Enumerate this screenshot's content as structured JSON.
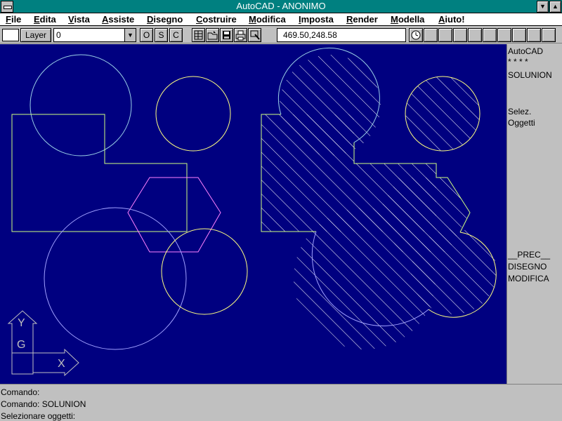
{
  "window": {
    "title": "AutoCAD - ANONIMO"
  },
  "menu": {
    "items": [
      {
        "label": "File"
      },
      {
        "label": "Edita"
      },
      {
        "label": "Vista"
      },
      {
        "label": "Assiste"
      },
      {
        "label": "Disegno"
      },
      {
        "label": "Costruire"
      },
      {
        "label": "Modifica"
      },
      {
        "label": "Imposta"
      },
      {
        "label": "Render"
      },
      {
        "label": "Modella"
      },
      {
        "label": "Aiuto!"
      }
    ]
  },
  "toolbar": {
    "layer_button": "Layer",
    "layer_value": "0",
    "ortho": "O",
    "snap": "S",
    "coords_toggle": "C",
    "coords": "469.50,248.58"
  },
  "sidemenu": {
    "header": "AutoCAD",
    "stars": "* * * *",
    "command": "SOLUNION",
    "select_1": "Selez.",
    "select_2": "Oggetti",
    "prev": "__PREC__",
    "draw": "DISEGNO",
    "modify": "MODIFICA"
  },
  "command": {
    "lines": [
      "Comando:",
      "Comando: SOLUNION",
      "Selezionare oggetti:"
    ]
  },
  "ucs": {
    "y_label": "Y",
    "g_label": "G",
    "x_label": "X"
  },
  "colors": {
    "drawing_bg": "#000080",
    "cyan": "#9ad0e6",
    "yellow": "#ffff80",
    "magenta": "#ff80ff",
    "violet": "#a0a0ff",
    "green_yellow": "#d0ff80",
    "ucs": "#c0c0c0"
  }
}
